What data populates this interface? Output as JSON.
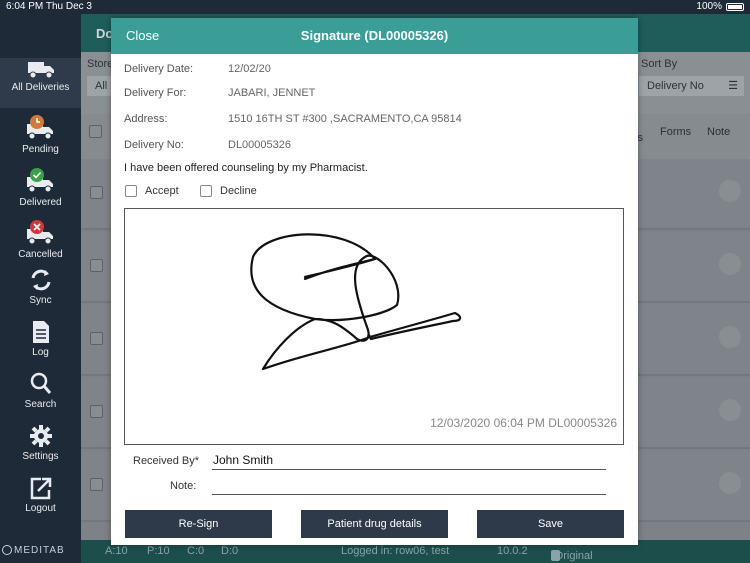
{
  "statusbar": {
    "time": "6:04 PM  Thu Dec 3",
    "battery": "100%"
  },
  "sidebar": {
    "items": [
      {
        "label": "All Deliveries",
        "icon": "truck-icon"
      },
      {
        "label": "Pending",
        "icon": "truck-clock-icon"
      },
      {
        "label": "Delivered",
        "icon": "truck-check-icon"
      },
      {
        "label": "Cancelled",
        "icon": "truck-cancel-icon"
      },
      {
        "label": "Sync",
        "icon": "sync-icon"
      },
      {
        "label": "Log",
        "icon": "document-icon"
      },
      {
        "label": "Search",
        "icon": "search-icon"
      },
      {
        "label": "Settings",
        "icon": "gear-icon"
      },
      {
        "label": "Logout",
        "icon": "logout-icon"
      }
    ],
    "logo": "MEDITAB"
  },
  "background": {
    "header_title": "Do",
    "store_label": "Store",
    "store_value": "All",
    "sort_label": "Sort By",
    "sort_value": "Delivery No",
    "columns": {
      "partial": "ls",
      "forms": "Forms",
      "note": "Note"
    },
    "footer": {
      "a": "A:10",
      "p": "P:10",
      "c": "C:0",
      "d": "D:0",
      "logged": "Logged in: row06, test",
      "version": "10.0.2",
      "note": "-Original Rx Required"
    }
  },
  "modal": {
    "close_label": "Close",
    "title": "Signature (DL00005326)",
    "fields": [
      {
        "label": "Delivery Date:",
        "value": "12/02/20"
      },
      {
        "label": "Delivery For:",
        "value": "JABARI, JENNET"
      },
      {
        "label": "Address:",
        "value": "1510 16TH ST #300 ,SACRAMENTO,CA 95814"
      },
      {
        "label": "Delivery No:",
        "value": "DL00005326"
      }
    ],
    "counseling_text": "I have been offered counseling by my Pharmacist.",
    "accept_label": "Accept",
    "decline_label": "Decline",
    "signature_stamp": "12/03/2020 06:04 PM  DL00005326",
    "received_by_label": "Received By*",
    "received_by_value": "John Smith",
    "note_label": "Note:",
    "note_value": "",
    "buttons": {
      "resign": "Re-Sign",
      "patient_drug": "Patient drug details",
      "save": "Save"
    }
  }
}
